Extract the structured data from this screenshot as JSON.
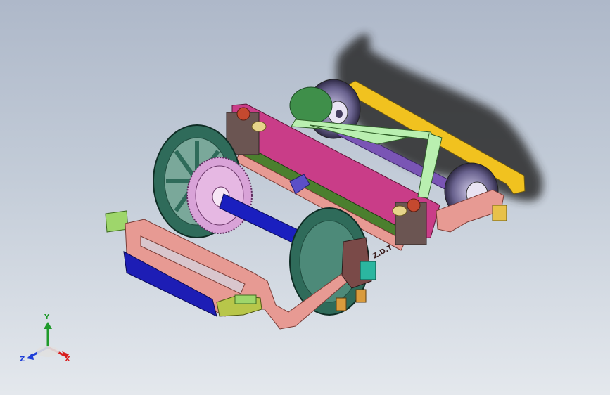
{
  "viewport": {
    "background_top": "#aeb8c9",
    "background_bottom": "#e4e8ed",
    "frame_text": "Z.D.T"
  },
  "triad": {
    "x_label": "X",
    "y_label": "Y",
    "z_label": "Z",
    "x_color": "#d81e1e",
    "y_color": "#1f9a2b",
    "z_color": "#1f3fd8"
  },
  "parts": {
    "front_wheel_color": "#2f6b5a",
    "gear_color": "#d9a3d8",
    "axle_color": "#1a1fbf",
    "rear_axle_color": "#7a55b5",
    "frame_color": "#e79a93",
    "bolster_color": "#1d1db5",
    "yellow_arm_color": "#f1c21f",
    "green_link_color": "#b9efb0",
    "beam_color": "#c93d88"
  }
}
